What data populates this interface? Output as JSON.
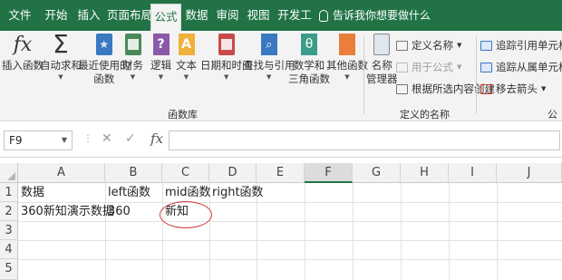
{
  "ribbon_tabs": [
    "文件",
    "开始",
    "插入",
    "页面布局",
    "公式",
    "数据",
    "审阅",
    "视图",
    "开发工具"
  ],
  "tell_me": "告诉我你想要做什么",
  "function_library": {
    "buttons": [
      {
        "label": "插入函数"
      },
      {
        "label": "自动求和",
        "has_dropdown": true
      },
      {
        "label": "最近使用的",
        "label2": "函数",
        "has_dropdown": true
      },
      {
        "label": "财务",
        "has_dropdown": true
      },
      {
        "label": "逻辑",
        "has_dropdown": true
      },
      {
        "label": "文本",
        "has_dropdown": true
      },
      {
        "label": "日期和时间",
        "has_dropdown": true
      },
      {
        "label": "查找与引用",
        "has_dropdown": true
      },
      {
        "label": "数学和",
        "label2": "三角函数",
        "has_dropdown": true
      },
      {
        "label": "其他函数",
        "has_dropdown": true
      }
    ],
    "group_title": "函数库"
  },
  "defined_names": {
    "name_manager": {
      "label": "名称",
      "label2": "管理器"
    },
    "define_name": "定义名称",
    "use_in_formula": "用于公式",
    "create_from_selection": "根据所选内容创建",
    "group_title": "定义的名称"
  },
  "formula_auditing": {
    "trace_precedents": "追踪引用单元格",
    "trace_dependents": "追踪从属单元格",
    "remove_arrows": "移去箭头",
    "group_title_partial": "公式"
  },
  "formula_bar": {
    "name_box": "F9",
    "cancel": "✕",
    "enter": "✓",
    "fx": "fx",
    "formula": ""
  },
  "sheet": {
    "columns": [
      "A",
      "B",
      "C",
      "D",
      "E",
      "F",
      "G",
      "H",
      "I",
      "J"
    ],
    "rows": [
      "1",
      "2",
      "3",
      "4",
      "5"
    ],
    "cells": {
      "A1": "数据",
      "B1": "left函数",
      "C1": "mid函数",
      "D1": "right函数",
      "A2": "360新知演示数据",
      "B2": "360",
      "C2": "新知"
    },
    "selected_cell": "F9",
    "annotation_color": "#d23b3b"
  },
  "colors": {
    "brand": "#217346"
  }
}
